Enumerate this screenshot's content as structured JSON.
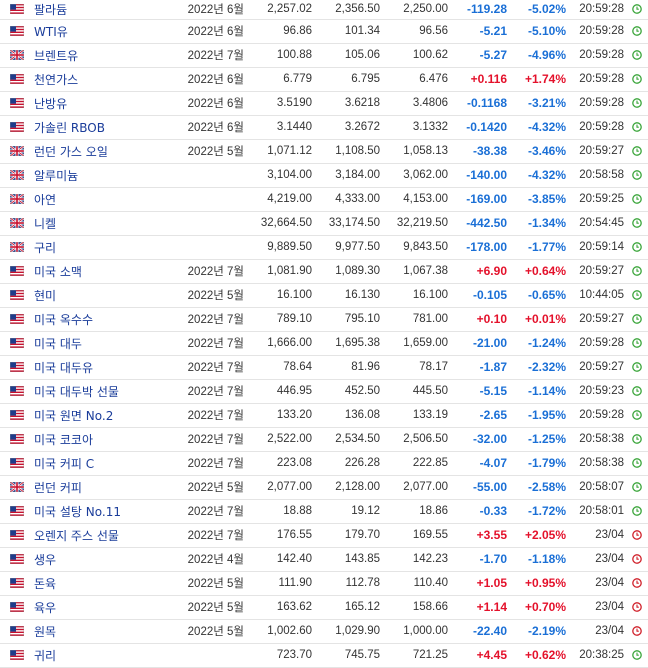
{
  "rows": [
    {
      "flag": "us",
      "name": "팔라듐",
      "month": "2022년 6월",
      "last": "2,257.02",
      "high": "2,356.50",
      "low": "2,250.00",
      "chg": "-119.28",
      "pct": "-5.02%",
      "dir": "down",
      "time": "20:59:28",
      "clock": "green"
    },
    {
      "flag": "us",
      "name": "WTI유",
      "month": "2022년 6월",
      "last": "96.86",
      "high": "101.34",
      "low": "96.56",
      "chg": "-5.21",
      "pct": "-5.10%",
      "dir": "down",
      "time": "20:59:28",
      "clock": "green"
    },
    {
      "flag": "uk",
      "name": "브렌트유",
      "month": "2022년 7월",
      "last": "100.88",
      "high": "105.06",
      "low": "100.62",
      "chg": "-5.27",
      "pct": "-4.96%",
      "dir": "down",
      "time": "20:59:28",
      "clock": "green"
    },
    {
      "flag": "us",
      "name": "천연가스",
      "month": "2022년 6월",
      "last": "6.779",
      "high": "6.795",
      "low": "6.476",
      "chg": "+0.116",
      "pct": "+1.74%",
      "dir": "up",
      "time": "20:59:28",
      "clock": "green"
    },
    {
      "flag": "us",
      "name": "난방유",
      "month": "2022년 6월",
      "last": "3.5190",
      "high": "3.6218",
      "low": "3.4806",
      "chg": "-0.1168",
      "pct": "-3.21%",
      "dir": "down",
      "time": "20:59:28",
      "clock": "green"
    },
    {
      "flag": "us",
      "name": "가솔린 RBOB",
      "month": "2022년 6월",
      "last": "3.1440",
      "high": "3.2672",
      "low": "3.1332",
      "chg": "-0.1420",
      "pct": "-4.32%",
      "dir": "down",
      "time": "20:59:28",
      "clock": "green"
    },
    {
      "flag": "uk",
      "name": "런던 가스 오일",
      "month": "2022년 5월",
      "last": "1,071.12",
      "high": "1,108.50",
      "low": "1,058.13",
      "chg": "-38.38",
      "pct": "-3.46%",
      "dir": "down",
      "time": "20:59:27",
      "clock": "green"
    },
    {
      "flag": "uk",
      "name": "알루미늄",
      "month": "",
      "last": "3,104.00",
      "high": "3,184.00",
      "low": "3,062.00",
      "chg": "-140.00",
      "pct": "-4.32%",
      "dir": "down",
      "time": "20:58:58",
      "clock": "green"
    },
    {
      "flag": "uk",
      "name": "아연",
      "month": "",
      "last": "4,219.00",
      "high": "4,333.00",
      "low": "4,153.00",
      "chg": "-169.00",
      "pct": "-3.85%",
      "dir": "down",
      "time": "20:59:25",
      "clock": "green"
    },
    {
      "flag": "uk",
      "name": "니켈",
      "month": "",
      "last": "32,664.50",
      "high": "33,174.50",
      "low": "32,219.50",
      "chg": "-442.50",
      "pct": "-1.34%",
      "dir": "down",
      "time": "20:54:45",
      "clock": "green"
    },
    {
      "flag": "uk",
      "name": "구리",
      "month": "",
      "last": "9,889.50",
      "high": "9,977.50",
      "low": "9,843.50",
      "chg": "-178.00",
      "pct": "-1.77%",
      "dir": "down",
      "time": "20:59:14",
      "clock": "green"
    },
    {
      "flag": "us",
      "name": "미국 소맥",
      "month": "2022년 7월",
      "last": "1,081.90",
      "high": "1,089.30",
      "low": "1,067.38",
      "chg": "+6.90",
      "pct": "+0.64%",
      "dir": "up",
      "time": "20:59:27",
      "clock": "green"
    },
    {
      "flag": "us",
      "name": "현미",
      "month": "2022년 5월",
      "last": "16.100",
      "high": "16.130",
      "low": "16.100",
      "chg": "-0.105",
      "pct": "-0.65%",
      "dir": "down",
      "time": "10:44:05",
      "clock": "green"
    },
    {
      "flag": "us",
      "name": "미국 옥수수",
      "month": "2022년 7월",
      "last": "789.10",
      "high": "795.10",
      "low": "781.00",
      "chg": "+0.10",
      "pct": "+0.01%",
      "dir": "up",
      "time": "20:59:27",
      "clock": "green"
    },
    {
      "flag": "us",
      "name": "미국 대두",
      "month": "2022년 7월",
      "last": "1,666.00",
      "high": "1,695.38",
      "low": "1,659.00",
      "chg": "-21.00",
      "pct": "-1.24%",
      "dir": "down",
      "time": "20:59:28",
      "clock": "green"
    },
    {
      "flag": "us",
      "name": "미국 대두유",
      "month": "2022년 7월",
      "last": "78.64",
      "high": "81.96",
      "low": "78.17",
      "chg": "-1.87",
      "pct": "-2.32%",
      "dir": "down",
      "time": "20:59:27",
      "clock": "green"
    },
    {
      "flag": "us",
      "name": "미국 대두박 선물",
      "month": "2022년 7월",
      "last": "446.95",
      "high": "452.50",
      "low": "445.50",
      "chg": "-5.15",
      "pct": "-1.14%",
      "dir": "down",
      "time": "20:59:23",
      "clock": "green"
    },
    {
      "flag": "us",
      "name": "미국 원면 No.2",
      "month": "2022년 7월",
      "last": "133.20",
      "high": "136.08",
      "low": "133.19",
      "chg": "-2.65",
      "pct": "-1.95%",
      "dir": "down",
      "time": "20:59:28",
      "clock": "green"
    },
    {
      "flag": "us",
      "name": "미국 코코아",
      "month": "2022년 7월",
      "last": "2,522.00",
      "high": "2,534.50",
      "low": "2,506.50",
      "chg": "-32.00",
      "pct": "-1.25%",
      "dir": "down",
      "time": "20:58:38",
      "clock": "green"
    },
    {
      "flag": "us",
      "name": "미국 커피 C",
      "month": "2022년 7월",
      "last": "223.08",
      "high": "226.28",
      "low": "222.85",
      "chg": "-4.07",
      "pct": "-1.79%",
      "dir": "down",
      "time": "20:58:38",
      "clock": "green"
    },
    {
      "flag": "uk",
      "name": "런던 커피",
      "month": "2022년 5월",
      "last": "2,077.00",
      "high": "2,128.00",
      "low": "2,077.00",
      "chg": "-55.00",
      "pct": "-2.58%",
      "dir": "down",
      "time": "20:58:07",
      "clock": "green"
    },
    {
      "flag": "us",
      "name": "미국 설탕 No.11",
      "month": "2022년 7월",
      "last": "18.88",
      "high": "19.12",
      "low": "18.86",
      "chg": "-0.33",
      "pct": "-1.72%",
      "dir": "down",
      "time": "20:58:01",
      "clock": "green"
    },
    {
      "flag": "us",
      "name": "오렌지 주스 선물",
      "month": "2022년 7월",
      "last": "176.55",
      "high": "179.70",
      "low": "169.55",
      "chg": "+3.55",
      "pct": "+2.05%",
      "dir": "up",
      "time": "23/04",
      "clock": "red"
    },
    {
      "flag": "us",
      "name": "생우",
      "month": "2022년 4월",
      "last": "142.40",
      "high": "143.85",
      "low": "142.23",
      "chg": "-1.70",
      "pct": "-1.18%",
      "dir": "down",
      "time": "23/04",
      "clock": "red"
    },
    {
      "flag": "us",
      "name": "돈육",
      "month": "2022년 5월",
      "last": "111.90",
      "high": "112.78",
      "low": "110.40",
      "chg": "+1.05",
      "pct": "+0.95%",
      "dir": "up",
      "time": "23/04",
      "clock": "red"
    },
    {
      "flag": "us",
      "name": "육우",
      "month": "2022년 5월",
      "last": "163.62",
      "high": "165.12",
      "low": "158.66",
      "chg": "+1.14",
      "pct": "+0.70%",
      "dir": "up",
      "time": "23/04",
      "clock": "red"
    },
    {
      "flag": "us",
      "name": "원목",
      "month": "2022년 5월",
      "last": "1,002.60",
      "high": "1,029.90",
      "low": "1,000.00",
      "chg": "-22.40",
      "pct": "-2.19%",
      "dir": "down",
      "time": "23/04",
      "clock": "red"
    },
    {
      "flag": "us",
      "name": "귀리",
      "month": "",
      "last": "723.70",
      "high": "745.75",
      "low": "721.25",
      "chg": "+4.45",
      "pct": "+0.62%",
      "dir": "up",
      "time": "20:38:25",
      "clock": "green"
    }
  ],
  "colors": {
    "up": "#e4112b",
    "down": "#1a6fd6",
    "clock_green": "#3aa53a",
    "clock_red": "#d0202a",
    "link": "#1a3c9a"
  }
}
